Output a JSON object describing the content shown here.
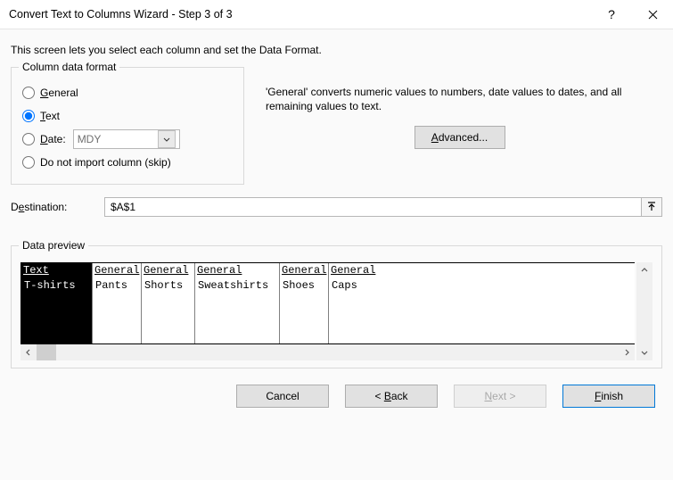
{
  "title": "Convert Text to Columns Wizard - Step 3 of 3",
  "intro": "This screen lets you select each column and set the Data Format.",
  "group_label": "Column data format",
  "options": {
    "general": "General",
    "text": "Text",
    "date": "Date:",
    "date_value": "MDY",
    "skip": "Do not import column (skip)"
  },
  "selected_option": "text",
  "description": "'General' converts numeric values to numbers, date values to dates, and all remaining values to text.",
  "advanced_label": "Advanced...",
  "destination": {
    "label": "Destination:",
    "value": "$A$1"
  },
  "preview": {
    "legend": "Data preview",
    "headers": [
      "Text",
      "General",
      "General",
      "General",
      "General",
      "General"
    ],
    "row": [
      "T-shirts",
      "Pants",
      "Shorts",
      "Sweatshirts",
      "Shoes",
      "Caps"
    ],
    "selected_col": 0
  },
  "buttons": {
    "cancel": "Cancel",
    "back": "< Back",
    "next": "Next >",
    "finish": "Finish"
  }
}
